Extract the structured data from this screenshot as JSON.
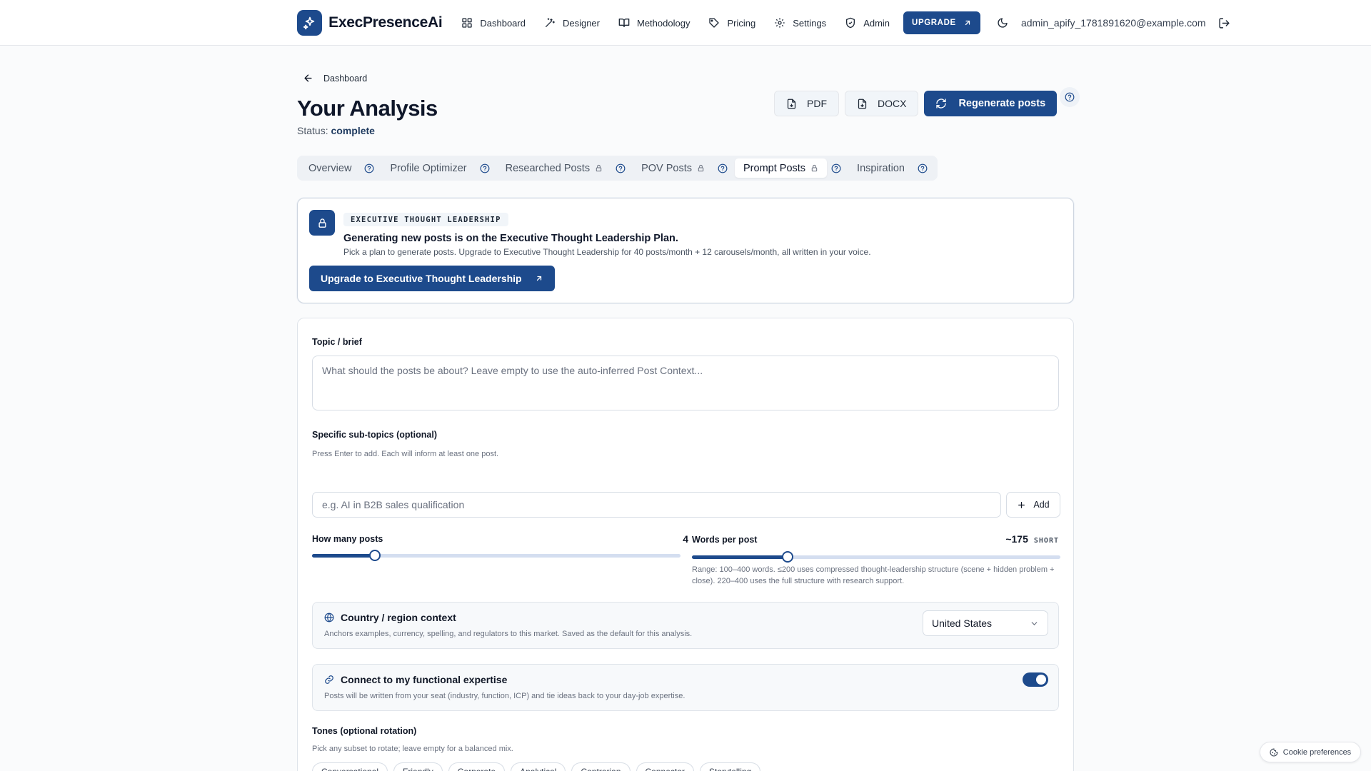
{
  "nav": {
    "brand": "ExecPresenceAi",
    "items": [
      {
        "label": "Dashboard",
        "icon": "grid-icon"
      },
      {
        "label": "Designer",
        "icon": "wand-icon"
      },
      {
        "label": "Methodology",
        "icon": "book-icon"
      },
      {
        "label": "Pricing",
        "icon": "tag-icon"
      },
      {
        "label": "Settings",
        "icon": "gear-icon"
      },
      {
        "label": "Admin",
        "icon": "shield-icon"
      }
    ],
    "upgrade_label": "UPGRADE",
    "user_email": "admin_apify_1781891620@example.com"
  },
  "header": {
    "back_label": "Dashboard",
    "title": "Your Analysis",
    "status_prefix": "Status:",
    "status_value": "complete",
    "pdf_label": "PDF",
    "docx_label": "DOCX",
    "regenerate_label": "Regenerate posts"
  },
  "tabs": [
    {
      "label": "Overview",
      "locked": false,
      "active": false
    },
    {
      "label": "Profile Optimizer",
      "locked": false,
      "active": false
    },
    {
      "label": "Researched Posts",
      "locked": true,
      "active": false
    },
    {
      "label": "POV Posts",
      "locked": true,
      "active": false
    },
    {
      "label": "Prompt Posts",
      "locked": true,
      "active": true
    },
    {
      "label": "Inspiration",
      "locked": false,
      "active": false
    }
  ],
  "banner": {
    "tag": "EXECUTIVE THOUGHT LEADERSHIP",
    "title": "Generating new posts is on the Executive Thought Leadership Plan.",
    "subtitle": "Pick a plan to generate posts. Upgrade to Executive Thought Leadership for 40 posts/month + 12 carousels/month, all written in your voice.",
    "cta": "Upgrade to Executive Thought Leadership"
  },
  "form": {
    "topic_label": "Topic / brief",
    "topic_placeholder": "What should the posts be about? Leave empty to use the auto-inferred Post Context...",
    "subtopics_label": "Specific sub-topics (optional)",
    "subtopics_hint": "Press Enter to add. Each will inform at least one post.",
    "subtopics_placeholder": "e.g. AI in B2B sales qualification",
    "add_label": "Add",
    "how_many_label": "How many posts",
    "how_many_value": "4",
    "how_many_fraction": 0.17,
    "words_label": "Words per post",
    "words_value": "~175",
    "words_tag": "SHORT",
    "words_fraction": 0.26,
    "words_note": "Range: 100–400 words. ≤200 uses compressed thought-leadership structure (scene + hidden problem + close). 220–400 uses the full structure with research support.",
    "country_title": "Country / region context",
    "country_desc": "Anchors examples, currency, spelling, and regulators to this market. Saved as the default for this analysis.",
    "country_value": "United States",
    "expertise_title": "Connect to my functional expertise",
    "expertise_desc": "Posts will be written from your seat (industry, function, ICP) and tie ideas back to your day-job expertise.",
    "expertise_enabled": true,
    "tones_label": "Tones (optional rotation)",
    "tones_hint": "Pick any subset to rotate; leave empty for a balanced mix.",
    "tones": [
      "Conversational",
      "Friendly",
      "Corporate",
      "Analytical",
      "Contrarian",
      "Connector",
      "Storytelling"
    ]
  },
  "cookie_label": "Cookie preferences",
  "colors": {
    "accent": "#1d4a8c",
    "background": "#fafbfc",
    "border": "#dfe4ea"
  }
}
